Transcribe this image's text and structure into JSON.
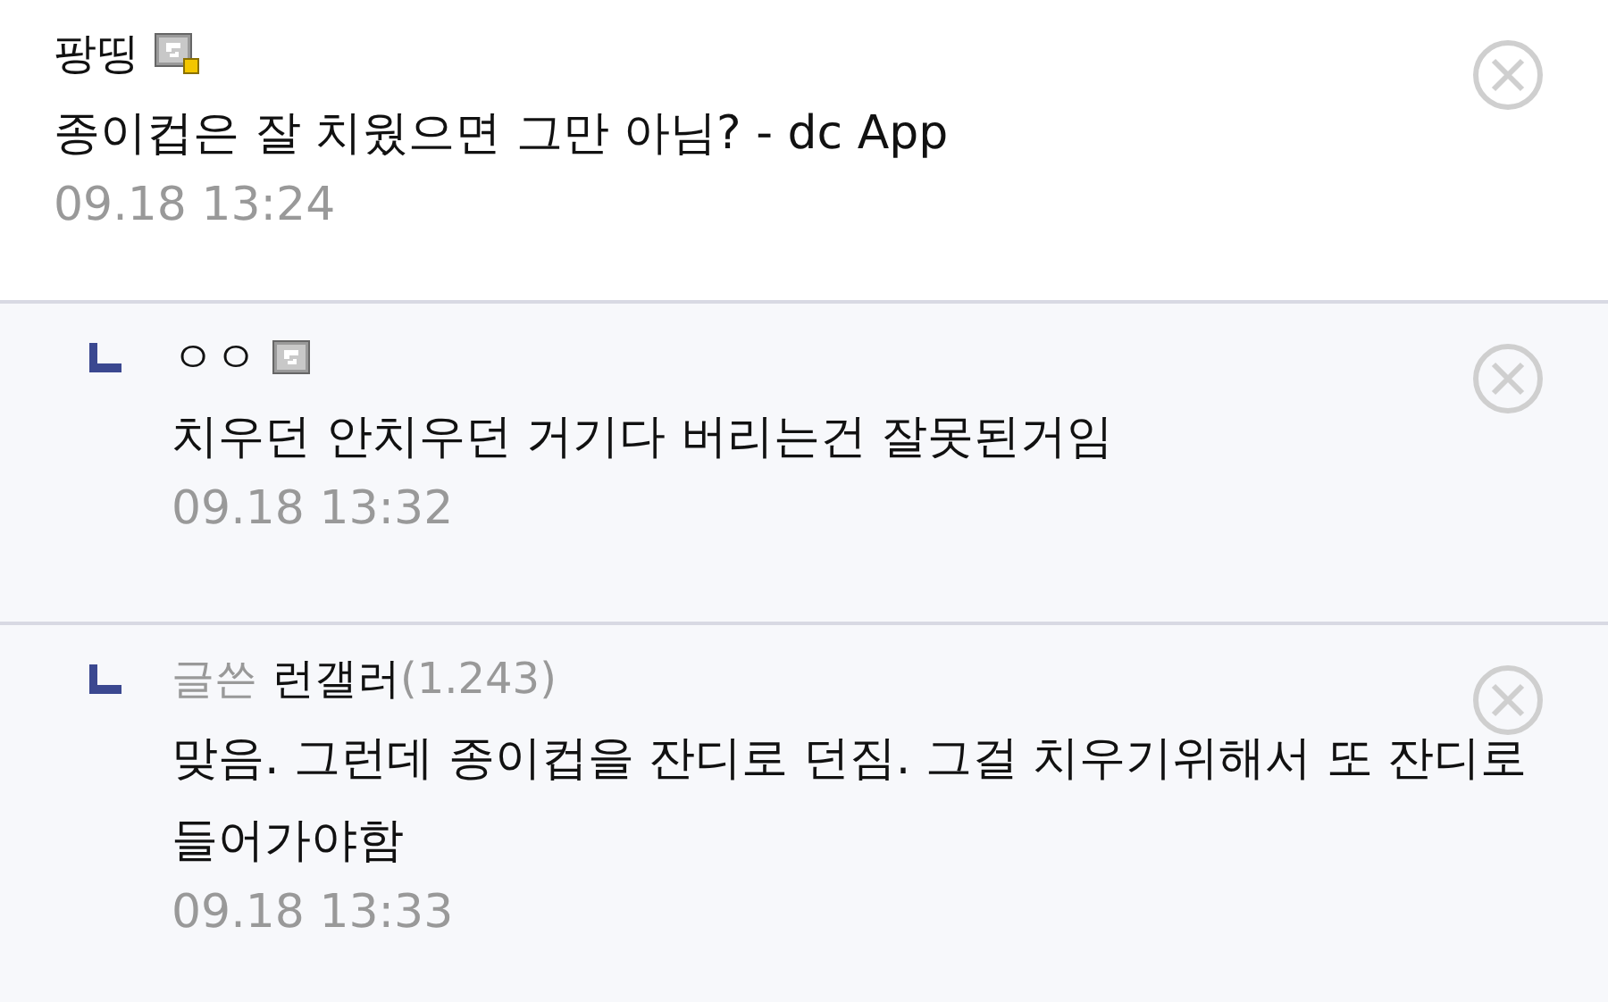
{
  "comments": [
    {
      "reply": false,
      "kind": "fixed",
      "author": "팡띵",
      "text": "종이컵은 잘 치웠으면 그만 아님? - dc App",
      "time": "09.18 13:24"
    },
    {
      "reply": true,
      "kind": "flowing",
      "author": "ㅇㅇ",
      "text": "치우던 안치우던 거기다 버리는건 잘못된거임",
      "time": "09.18 13:32"
    },
    {
      "reply": true,
      "kind": "writer",
      "writer_tag": "글쓴",
      "author": "런갤러",
      "ip": "(1.243)",
      "text": "맞음. 그런데 종이컵을 잔디로 던짐. 그걸 치우기위해서 또 잔디로 들어가야함",
      "time": "09.18 13:33"
    }
  ]
}
